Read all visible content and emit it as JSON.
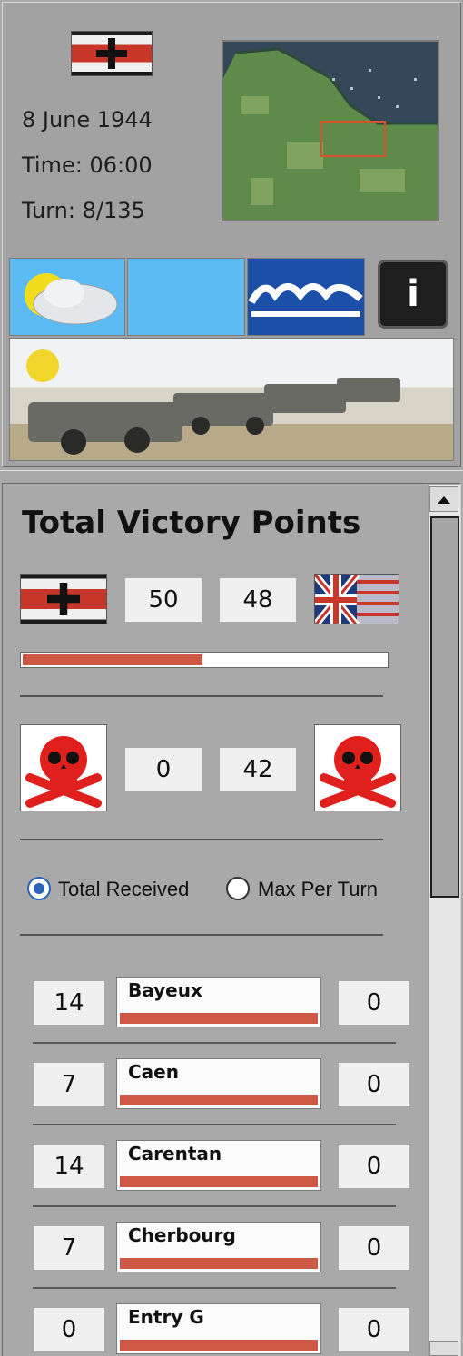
{
  "header": {
    "date": "8 June 1944",
    "time": "Time: 06:00",
    "turn": "Turn: 8/135"
  },
  "weather": {
    "condition_icon": "partly-cloudy-icon",
    "sky_icon": "clear-sky-icon",
    "sea_icon": "sea-waves-icon",
    "info_label": "i"
  },
  "victory": {
    "title": "Total Victory Points",
    "axis_vp": "50",
    "allied_vp": "48",
    "vp_progress_fraction": 0.5,
    "axis_losses": "0",
    "allied_losses": "42",
    "radio": {
      "total_received": "Total Received",
      "max_per_turn": "Max Per Turn",
      "selected": "total_received"
    }
  },
  "objectives": [
    {
      "left": "14",
      "name": "Bayeux",
      "right": "0"
    },
    {
      "left": "7",
      "name": "Caen",
      "right": "0"
    },
    {
      "left": "14",
      "name": "Carentan",
      "right": "0"
    },
    {
      "left": "7",
      "name": "Cherbourg",
      "right": "0"
    },
    {
      "left": "0",
      "name": "Entry G",
      "right": "0"
    }
  ],
  "colors": {
    "accent_red": "#cd5845",
    "radio_blue": "#2b63b8",
    "panel_gray": "#a9a9a9"
  }
}
